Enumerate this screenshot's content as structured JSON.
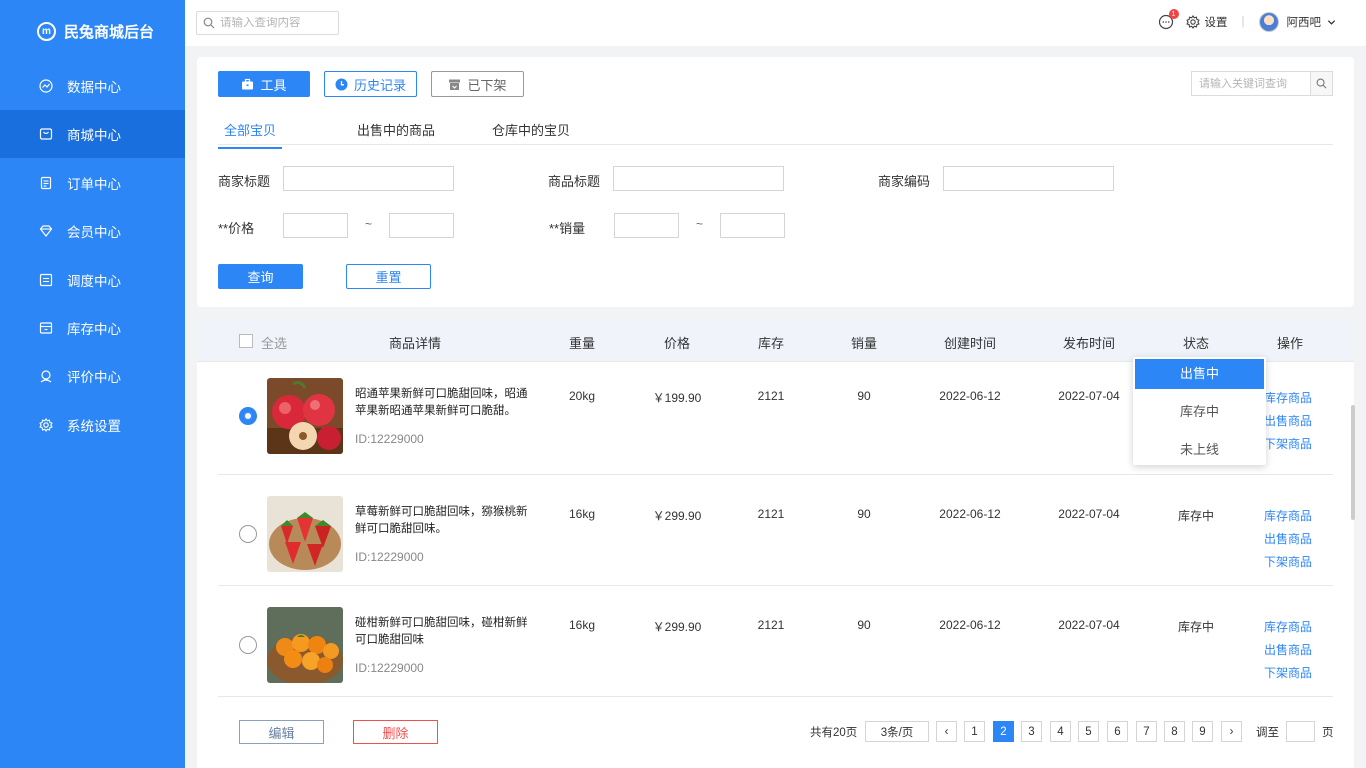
{
  "app": {
    "title": "民兔商城后台",
    "logo_text": "m"
  },
  "sidebar": {
    "items": [
      {
        "label": "数据中心",
        "icon": "chart-icon"
      },
      {
        "label": "商城中心",
        "icon": "shop-icon",
        "active": true
      },
      {
        "label": "订单中心",
        "icon": "order-icon"
      },
      {
        "label": "会员中心",
        "icon": "diamond-icon"
      },
      {
        "label": "调度中心",
        "icon": "dispatch-icon"
      },
      {
        "label": "库存中心",
        "icon": "inventory-icon"
      },
      {
        "label": "评价中心",
        "icon": "review-icon"
      },
      {
        "label": "系统设置",
        "icon": "gear-icon"
      }
    ]
  },
  "topbar": {
    "search_placeholder": "请输入查询内容",
    "message_count": "1",
    "settings_label": "设置",
    "divider": "|",
    "username": "阿西吧"
  },
  "toolbar": {
    "tools_label": "工具",
    "history_label": "历史记录",
    "offshelf_label": "已下架",
    "keyword_placeholder": "请输入关键词查询"
  },
  "tabs": [
    "全部宝贝",
    "出售中的商品",
    "仓库中的宝贝"
  ],
  "filters": {
    "merchant_title": "商家标题",
    "product_title": "商品标题",
    "merchant_code": "商家编码",
    "price": "**价格",
    "sales": "**销量",
    "range_sep": "~",
    "query_label": "查询",
    "reset_label": "重置"
  },
  "table": {
    "select_all": "全选",
    "headers": [
      "商品详情",
      "重量",
      "价格",
      "库存",
      "销量",
      "创建时间",
      "发布时间",
      "状态",
      "操作"
    ],
    "rows": [
      {
        "name": "昭通苹果新鲜可口脆甜回味，昭通苹果新昭通苹果新鲜可口脆甜。",
        "id": "ID:12229000",
        "weight": "20kg",
        "price": "￥199.90",
        "stock": "2121",
        "sales": "90",
        "created": "2022-06-12",
        "published": "2022-07-04",
        "status": "",
        "ops": [
          "库存商品",
          "出售商品",
          "下架商品"
        ],
        "selected": true,
        "image": "apple"
      },
      {
        "name": "草莓新鲜可口脆甜回味，猕猴桃新鲜可口脆甜回味。",
        "id": "ID:12229000",
        "weight": "16kg",
        "price": "￥299.90",
        "stock": "2121",
        "sales": "90",
        "created": "2022-06-12",
        "published": "2022-07-04",
        "status": "库存中",
        "ops": [
          "库存商品",
          "出售商品",
          "下架商品"
        ],
        "selected": false,
        "image": "strawberry"
      },
      {
        "name": "碰柑新鲜可口脆甜回味，碰柑新鲜可口脆甜回味",
        "id": "ID:12229000",
        "weight": "16kg",
        "price": "￥299.90",
        "stock": "2121",
        "sales": "90",
        "created": "2022-06-12",
        "published": "2022-07-04",
        "status": "库存中",
        "ops": [
          "库存商品",
          "出售商品",
          "下架商品"
        ],
        "selected": false,
        "image": "orange"
      }
    ]
  },
  "status_dropdown": {
    "options": [
      "出售中",
      "库存中",
      "未上线"
    ],
    "selected": "出售中"
  },
  "footer": {
    "edit_label": "编辑",
    "delete_label": "删除",
    "total": "共有20页",
    "page_size": "3条/页",
    "pages": [
      "1",
      "2",
      "3",
      "4",
      "5",
      "6",
      "7",
      "8",
      "9"
    ],
    "current_page": "2",
    "prev": "‹",
    "next": "›",
    "jump_prefix": "调至",
    "jump_suffix": "页"
  },
  "colors": {
    "primary": "#2d86f5",
    "sidebar_active": "#1a6fdf",
    "danger": "#f05050"
  }
}
